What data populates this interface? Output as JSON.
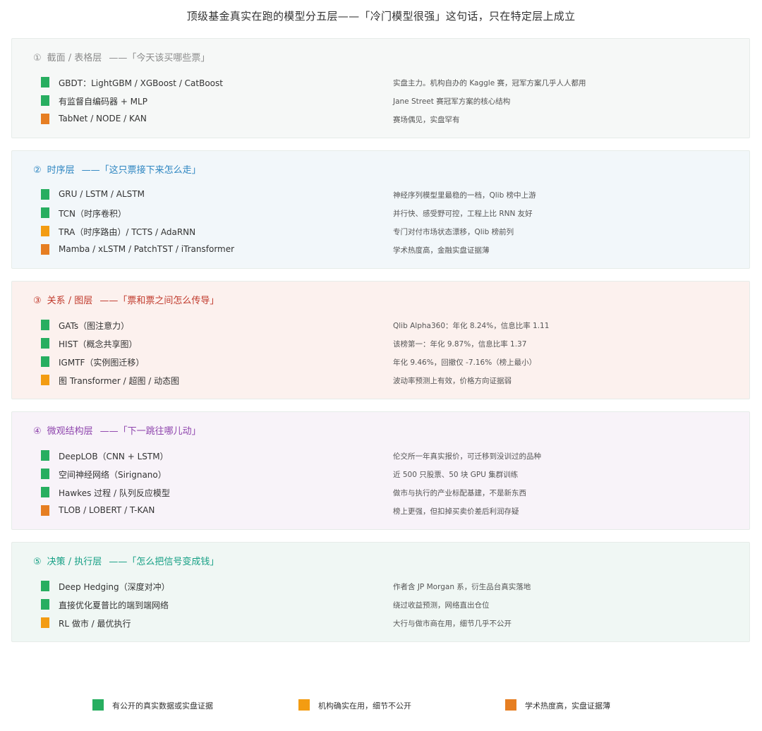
{
  "title": "顶级基金真实在跑的模型分五层——「冷门模型很强」这句话，只在特定层上成立",
  "colors": {
    "green": "#27ae60",
    "amber": "#f39c12",
    "orange": "#e67e22"
  },
  "layers": [
    {
      "num": "①",
      "name": "截面 / 表格层",
      "tag": "——「今天该买哪些票」",
      "accent": "#8c8c8c",
      "background": "#f6f8f7",
      "items": [
        {
          "status": "green",
          "name": "GBDT：LightGBM / XGBoost / CatBoost",
          "note": "实盘主力。机构自办的 Kaggle 赛，冠军方案几乎人人都用"
        },
        {
          "status": "green",
          "name": "有监督自编码器 + MLP",
          "note": "Jane Street 赛冠军方案的核心结构"
        },
        {
          "status": "orange",
          "name": "TabNet / NODE / KAN",
          "note": "赛场偶见，实盘罕有"
        }
      ]
    },
    {
      "num": "②",
      "name": "时序层",
      "tag": "——「这只票接下来怎么走」",
      "accent": "#2e86c1",
      "background": "#f2f7fa",
      "items": [
        {
          "status": "green",
          "name": "GRU / LSTM / ALSTM",
          "note": "神经序列模型里最稳的一档，Qlib 榜中上游"
        },
        {
          "status": "green",
          "name": "TCN（时序卷积）",
          "note": "并行快、感受野可控，工程上比 RNN 友好"
        },
        {
          "status": "amber",
          "name": "TRA（时序路由）/ TCTS / AdaRNN",
          "note": "专门对付市场状态漂移，Qlib 榜前列"
        },
        {
          "status": "orange",
          "name": "Mamba / xLSTM / PatchTST / iTransformer",
          "note": "学术热度高，金融实盘证据薄"
        }
      ]
    },
    {
      "num": "③",
      "name": "关系 / 图层",
      "tag": "——「票和票之间怎么传导」",
      "accent": "#c0392b",
      "background": "#fcf1ee",
      "items": [
        {
          "status": "green",
          "name": "GATs（图注意力）",
          "note": "Qlib Alpha360：年化 8.24%，信息比率 1.11"
        },
        {
          "status": "green",
          "name": "HIST（概念共享图）",
          "note": "该榜第一：年化 9.87%，信息比率 1.37"
        },
        {
          "status": "green",
          "name": "IGMTF（实例图迁移）",
          "note": "年化 9.46%，回撤仅 -7.16%（榜上最小）"
        },
        {
          "status": "amber",
          "name": "图 Transformer / 超图 / 动态图",
          "note": "波动率预测上有效，价格方向证据弱"
        }
      ]
    },
    {
      "num": "④",
      "name": "微观结构层",
      "tag": "——「下一跳往哪儿动」",
      "accent": "#8e44ad",
      "background": "#f8f3f9",
      "items": [
        {
          "status": "green",
          "name": "DeepLOB（CNN + LSTM）",
          "note": "伦交所一年真实报价，可迁移到没训过的品种"
        },
        {
          "status": "green",
          "name": "空间神经网络（Sirignano）",
          "note": "近 500 只股票、50 块 GPU 集群训练"
        },
        {
          "status": "green",
          "name": "Hawkes 过程 / 队列反应模型",
          "note": "做市与执行的产业标配基建，不是新东西"
        },
        {
          "status": "orange",
          "name": "TLOB / LOBERT / T-KAN",
          "note": "榜上更强，但扣掉买卖价差后利润存疑"
        }
      ]
    },
    {
      "num": "⑤",
      "name": "决策 / 执行层",
      "tag": "——「怎么把信号变成钱」",
      "accent": "#16a085",
      "background": "#f0f7f4",
      "items": [
        {
          "status": "green",
          "name": "Deep Hedging（深度对冲）",
          "note": "作者含 JP Morgan 系，衍生品台真实落地"
        },
        {
          "status": "green",
          "name": "直接优化夏普比的端到端网络",
          "note": "绕过收益预测，网络直出仓位"
        },
        {
          "status": "amber",
          "name": "RL 做市 / 最优执行",
          "note": "大行与做市商在用，细节几乎不公开"
        }
      ]
    }
  ],
  "legend": [
    {
      "status": "green",
      "label": "有公开的真实数据或实盘证据"
    },
    {
      "status": "amber",
      "label": "机构确实在用，细节不公开"
    },
    {
      "status": "orange",
      "label": "学术热度高，实盘证据薄"
    }
  ]
}
